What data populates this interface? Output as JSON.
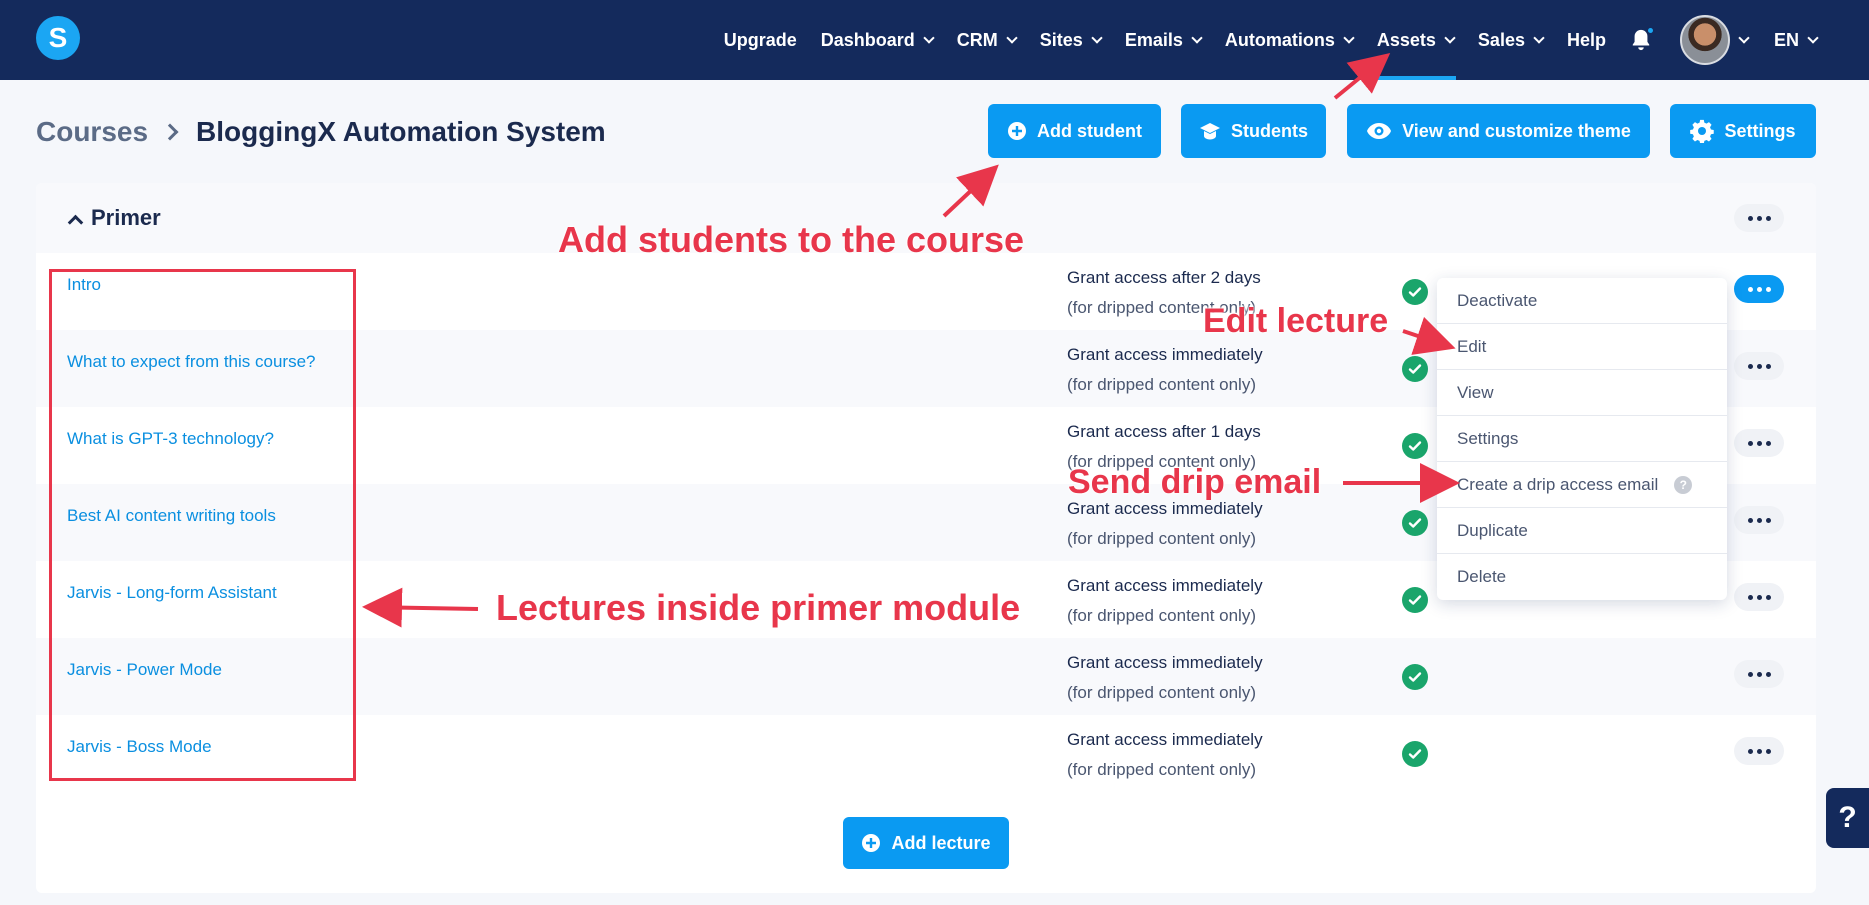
{
  "nav": {
    "logo_letter": "S",
    "items": [
      {
        "label": "Upgrade",
        "dropdown": false
      },
      {
        "label": "Dashboard",
        "dropdown": true
      },
      {
        "label": "CRM",
        "dropdown": true
      },
      {
        "label": "Sites",
        "dropdown": true
      },
      {
        "label": "Emails",
        "dropdown": true
      },
      {
        "label": "Automations",
        "dropdown": true
      },
      {
        "label": "Assets",
        "dropdown": true,
        "active": true
      },
      {
        "label": "Sales",
        "dropdown": true
      },
      {
        "label": "Help",
        "dropdown": false
      }
    ],
    "language": "EN"
  },
  "breadcrumb": {
    "root": "Courses",
    "current": "BloggingX Automation System"
  },
  "actions": {
    "add_student": "Add student",
    "students": "Students",
    "view_theme": "View and customize theme",
    "settings": "Settings"
  },
  "module": {
    "title": "Primer",
    "add_lecture": "Add lecture",
    "lectures": [
      {
        "title": "Intro",
        "access": "Grant access after 2 days",
        "note": "(for dripped content only)"
      },
      {
        "title": "What to expect from this course?",
        "access": "Grant access immediately",
        "note": "(for dripped content only)"
      },
      {
        "title": "What is GPT-3 technology?",
        "access": "Grant access after 1 days",
        "note": "(for dripped content only)"
      },
      {
        "title": "Best AI content writing tools",
        "access": "Grant access immediately",
        "note": "(for dripped content only)"
      },
      {
        "title": "Jarvis - Long-form Assistant",
        "access": "Grant access immediately",
        "note": "(for dripped content only)"
      },
      {
        "title": "Jarvis - Power Mode",
        "access": "Grant access immediately",
        "note": "(for dripped content only)"
      },
      {
        "title": "Jarvis - Boss Mode",
        "access": "Grant access immediately",
        "note": "(for dripped content only)"
      }
    ]
  },
  "dropdown_menu": {
    "items": [
      "Deactivate",
      "Edit",
      "View",
      "Settings",
      "Create a drip access email",
      "Duplicate",
      "Delete"
    ],
    "help_glyph": "?"
  },
  "annotations": {
    "add_students": "Add students to the course",
    "edit_lecture": "Edit lecture",
    "send_drip": "Send drip email",
    "lectures_inside": "Lectures inside primer module"
  },
  "help_tab": "?",
  "colors": {
    "nav_bg": "#142a5c",
    "accent": "#0a9af2",
    "annotation": "#e8364b",
    "success": "#1aa56b"
  }
}
